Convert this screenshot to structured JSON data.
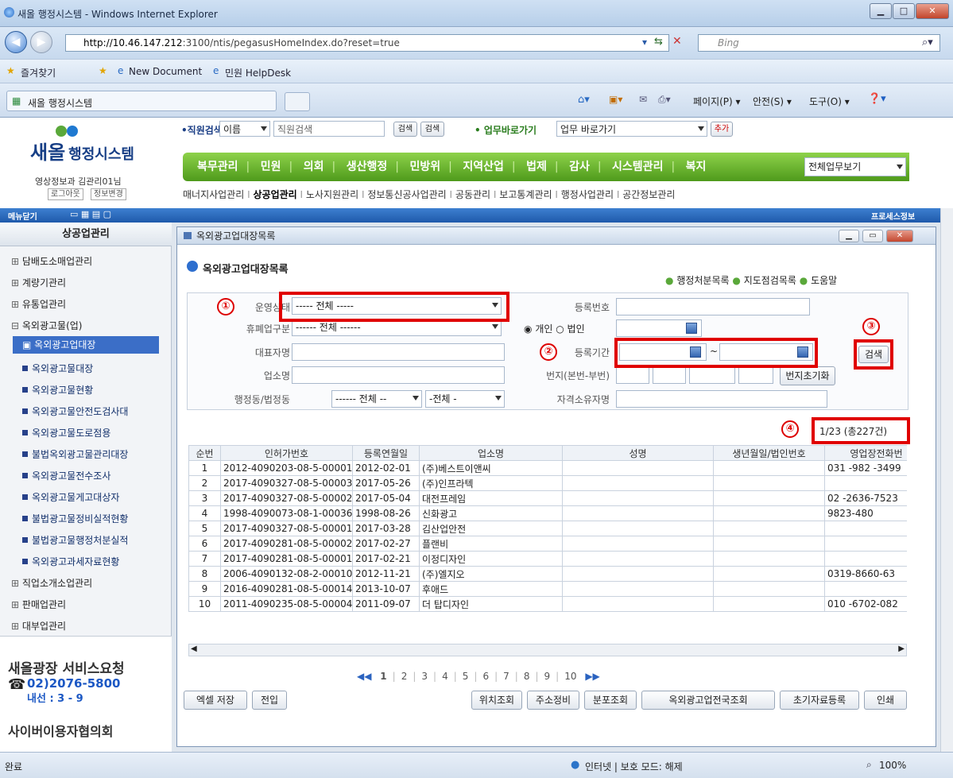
{
  "window": {
    "title": "새올 행정시스템 - Windows Internet Explorer"
  },
  "browser": {
    "url_host": "http://10.46.147.212",
    "url_rest": ":3100/ntis/pegasusHomeIndex.do?reset=true",
    "search_placeholder": "Bing",
    "favorites_label": "즐겨찾기",
    "fav_links": [
      "New Document",
      "민원 HelpDesk"
    ],
    "tab_title": "새올 행정시스템",
    "cmd_page": "페이지(P) ▾",
    "cmd_safety": "안전(S) ▾",
    "cmd_tools": "도구(O) ▾"
  },
  "header": {
    "logo_main": "새올",
    "logo_sub": "행정시스템",
    "user": "영상정보과 김관리01님",
    "logout": "로그아웃",
    "info_change": "정보변경",
    "staff_search_label": "•직원검색",
    "staff_search_type": "이름",
    "staff_search_placeholder": "직원검색",
    "search_btn1": "검색",
    "search_btn2": "검색",
    "quick_label": "• 업무바로가기",
    "quick_value": "업무 바로가기",
    "add_btn": "추가",
    "menu": [
      "복무관리",
      "민원",
      "의회",
      "생산행정",
      "민방위",
      "지역산업",
      "법제",
      "감사",
      "시스템관리",
      "복지"
    ],
    "all_menu": "전체업무보기",
    "submenu": [
      "매너지사업관리",
      "상공업관리",
      "노사지원관리",
      "정보통신공사업관리",
      "공동관리",
      "보고통계관리",
      "행정사업관리",
      "공간정보관리"
    ],
    "menu_close": "메뉴닫기",
    "process_info": "프로세스정보"
  },
  "sidebar": {
    "title": "상공업관리",
    "items": [
      {
        "label": "담배도소매업관리",
        "type": "group"
      },
      {
        "label": "계량기관리",
        "type": "group"
      },
      {
        "label": "유통업관리",
        "type": "group"
      },
      {
        "label": "옥외광고물(업)",
        "type": "open"
      },
      {
        "label": "옥외광고업대장",
        "type": "selected"
      },
      {
        "label": "옥외광고물대장",
        "type": "sub"
      },
      {
        "label": "옥외광고물현황",
        "type": "sub"
      },
      {
        "label": "옥외광고물안전도검사대",
        "type": "sub"
      },
      {
        "label": "옥외광고물도로점용",
        "type": "sub"
      },
      {
        "label": "불법옥외광고물관리대장",
        "type": "sub"
      },
      {
        "label": "옥외광고물전수조사",
        "type": "sub"
      },
      {
        "label": "옥외광고물게고대상자",
        "type": "sub"
      },
      {
        "label": "불법광고물정비실적현황",
        "type": "sub"
      },
      {
        "label": "불법광고물행정처분실적",
        "type": "sub"
      },
      {
        "label": "옥외광고과세자료현황",
        "type": "sub"
      },
      {
        "label": "직업소개소업관리",
        "type": "group"
      },
      {
        "label": "판매업관리",
        "type": "group"
      },
      {
        "label": "대부업관리",
        "type": "group"
      }
    ],
    "promo1": "새올광장 서비스요청",
    "phone": "02)2076-5800",
    "ext": "내선 : 3 - 9",
    "promo2": "사이버이용자협의회"
  },
  "panel": {
    "window_title": "옥외광고업대장목록",
    "heading": "옥외광고업대장목록",
    "links": [
      "행정처분목록",
      "지도점검목록",
      "도움말"
    ],
    "form": {
      "status_label": "운영상태",
      "status_value": "----- 전체 -----",
      "closure_label": "휴폐업구분",
      "closure_value": "------ 전체 ------",
      "rep_label": "대표자명",
      "biz_label": "업소명",
      "dong_label": "행정동/법정동",
      "dong_value1": "------ 전체 --",
      "dong_value2": "-전체 -",
      "regno_label": "등록번호",
      "person_opt": "개인",
      "corp_opt": "법인",
      "period_label": "등록기간",
      "tilde": "~",
      "lot_label": "번지(본번-부번)",
      "lot_reset": "번지초기화",
      "owner_label": "자격소유자명",
      "search_btn": "검색"
    },
    "markers": [
      "①",
      "②",
      "③",
      "④"
    ],
    "paging": "1/23 (총227건)",
    "table": {
      "headers": [
        "순번",
        "인허가번호",
        "등록연월일",
        "업소명",
        "성명",
        "생년월일/법인번호",
        "영업장전화번"
      ],
      "rows": [
        [
          "1",
          "2012-4090203-08-5-00001",
          "2012-02-01",
          "(주)베스트이앤씨",
          "",
          "",
          "031 -982 -3499"
        ],
        [
          "2",
          "2017-4090327-08-5-00003",
          "2017-05-26",
          "(주)인프라텍",
          "",
          "",
          ""
        ],
        [
          "3",
          "2017-4090327-08-5-00002",
          "2017-05-04",
          "대전프레임",
          "",
          "",
          "02 -2636-7523"
        ],
        [
          "4",
          "1998-4090073-08-1-00036",
          "1998-08-26",
          "신화광고",
          "",
          "",
          "9823-480"
        ],
        [
          "5",
          "2017-4090327-08-5-00001",
          "2017-03-28",
          "김산업안전",
          "",
          "",
          ""
        ],
        [
          "6",
          "2017-4090281-08-5-00002",
          "2017-02-27",
          "플랜비",
          "",
          "",
          ""
        ],
        [
          "7",
          "2017-4090281-08-5-00001",
          "2017-02-21",
          "이정디자인",
          "",
          "",
          ""
        ],
        [
          "8",
          "2006-4090132-08-2-00010",
          "2012-11-21",
          "(주)엘지오",
          "",
          "",
          "0319-8660-63"
        ],
        [
          "9",
          "2016-4090281-08-5-00014",
          "2013-10-07",
          "후애드",
          "",
          "",
          ""
        ],
        [
          "10",
          "2011-4090235-08-5-00004",
          "2011-09-07",
          "더 탑디자인",
          "",
          "",
          "010 -6702-082"
        ]
      ]
    },
    "pages": [
      "1",
      "2",
      "3",
      "4",
      "5",
      "6",
      "7",
      "8",
      "9",
      "10"
    ],
    "buttons_left": [
      "엑셀 저장",
      "전입"
    ],
    "buttons_right": [
      "위치조회",
      "주소정비",
      "분포조회",
      "옥외광고업전국조회",
      "초기자료등록",
      "인쇄"
    ]
  },
  "status": {
    "left": "완료",
    "zone": "인터넷 | 보호 모드: 해제",
    "zoom": "100%"
  }
}
